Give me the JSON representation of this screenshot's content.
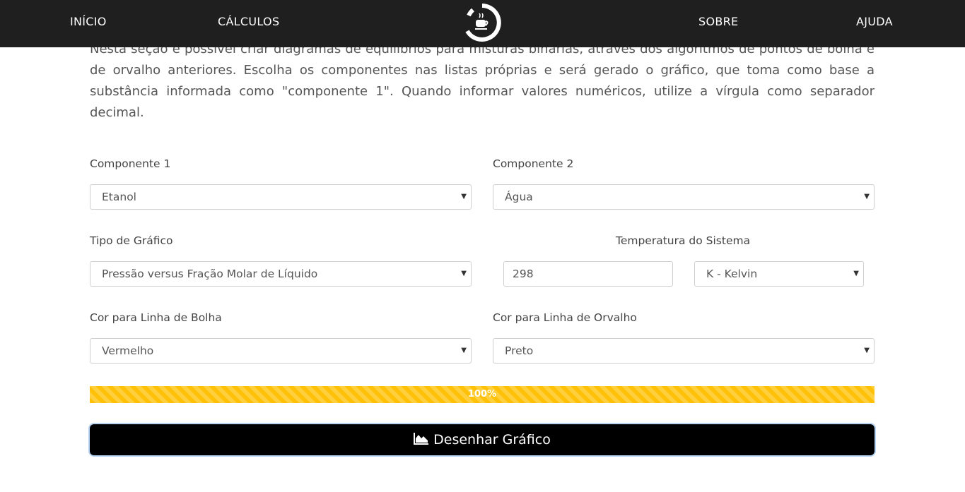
{
  "nav": {
    "inicio": "INÍCIO",
    "calculos": "CÁLCULOS",
    "sobre": "SOBRE",
    "ajuda": "AJUDA",
    "logo_icon": "coffee-cup-logo-icon"
  },
  "intro_text": "Nesta seção é possível criar diagramas de equilíbrios para misturas binárias, através dos algoritmos de pontos de bolha e de orvalho anteriores. Escolha os componentes nas listas próprias e será gerado o gráfico, que toma como base a substância informada como \"componente 1\". Quando informar valores numéricos, utilize a vírgula como separador decimal.",
  "form": {
    "componente1_label": "Componente 1",
    "componente1_value": "Etanol",
    "componente2_label": "Componente 2",
    "componente2_value": "Água",
    "tipo_label": "Tipo de Gráfico",
    "tipo_value": "Pressão versus Fração Molar de Líquido",
    "temperatura_label": "Temperatura do Sistema",
    "temperatura_value": "298",
    "unidade_value": "K - Kelvin",
    "bolha_label": "Cor para Linha de Bolha",
    "bolha_value": "Vermelho",
    "orvalho_label": "Cor para Linha de Orvalho",
    "orvalho_value": "Preto"
  },
  "progress": {
    "value": 100,
    "label": "100%",
    "color": "#ffc107"
  },
  "draw_button": {
    "label": "Desenhar Gráfico",
    "icon": "area-chart-icon"
  }
}
